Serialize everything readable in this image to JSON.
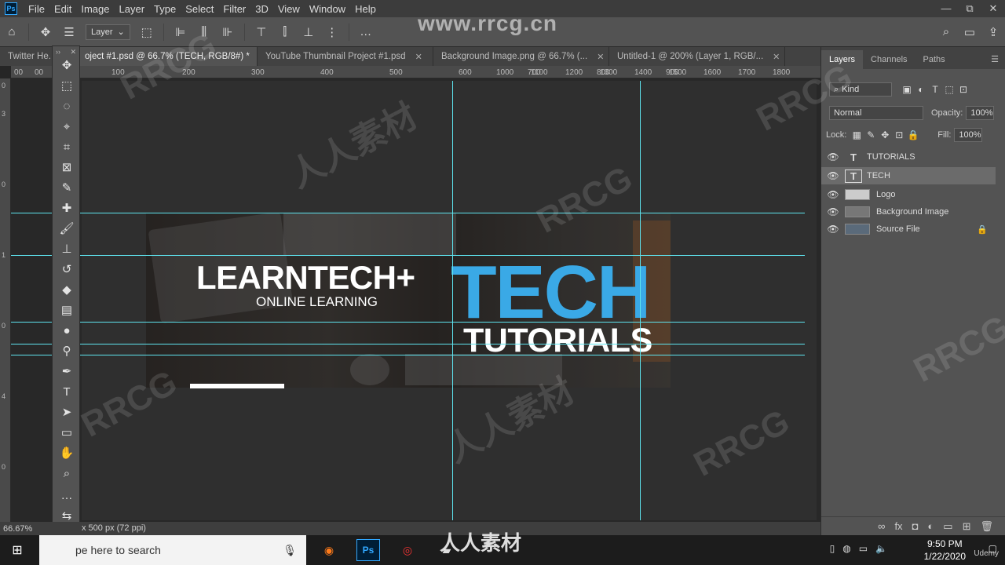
{
  "menubar": {
    "logo": "Ps",
    "items": [
      "File",
      "Edit",
      "Image",
      "Layer",
      "Type",
      "Select",
      "Filter",
      "3D",
      "View",
      "Window",
      "Help"
    ],
    "window_controls": [
      "—",
      "⧉",
      "✕"
    ]
  },
  "optionsbar": {
    "auto_select_value": "Layer"
  },
  "tabs": [
    {
      "label": "Twitter He...",
      "active": false
    },
    {
      "label": "oject #1.psd @ 66.7% (TECH, RGB/8#) *",
      "active": true
    },
    {
      "label": "YouTube Thumbnail Project #1.psd",
      "active": false
    },
    {
      "label": "Background Image.png @ 66.7% (...",
      "active": false
    },
    {
      "label": "Untitled-1 @ 200% (Layer 1, RGB/...",
      "active": false
    }
  ],
  "ruler": {
    "h_ticks": [
      "00",
      "00",
      "100",
      "200",
      "300",
      "400",
      "500",
      "600",
      "700",
      "800",
      "900",
      "1000",
      "1100",
      "1200",
      "1300",
      "1400",
      "1500",
      "1600",
      "1700",
      "1800"
    ]
  },
  "document": {
    "title": "LEARNTECH+",
    "subtitle": "ONLINE LEARNING",
    "headline": "TECH",
    "subheadline": "TUTORIALS",
    "accent_color": "#3aa9e6"
  },
  "status": {
    "zoom": "66.67%",
    "doc_info": "x 500 px (72 ppi)"
  },
  "layers_panel": {
    "tabs": [
      "Layers",
      "Channels",
      "Paths"
    ],
    "filter": "Kind",
    "blend_mode": "Normal",
    "opacity_label": "Opacity:",
    "opacity": "100%",
    "lock_label": "Lock:",
    "fill_label": "Fill:",
    "fill": "100%",
    "layers": [
      {
        "name": "TUTORIALS",
        "kind": "text",
        "selected": false,
        "locked": false
      },
      {
        "name": "TECH",
        "kind": "text",
        "selected": true,
        "locked": false
      },
      {
        "name": "Logo",
        "kind": "image",
        "selected": false,
        "locked": false
      },
      {
        "name": "Background Image",
        "kind": "image",
        "selected": false,
        "locked": false
      },
      {
        "name": "Source File",
        "kind": "image",
        "selected": false,
        "locked": true
      }
    ]
  },
  "taskbar": {
    "search_placeholder": "pe here to search",
    "time": "9:50 PM",
    "date": "1/22/2020"
  },
  "watermarks": {
    "top": "www.rrcg.cn",
    "bottom": "人人素材",
    "tiles": [
      "RRCG",
      "人人素材"
    ],
    "corner": "Udemy"
  }
}
